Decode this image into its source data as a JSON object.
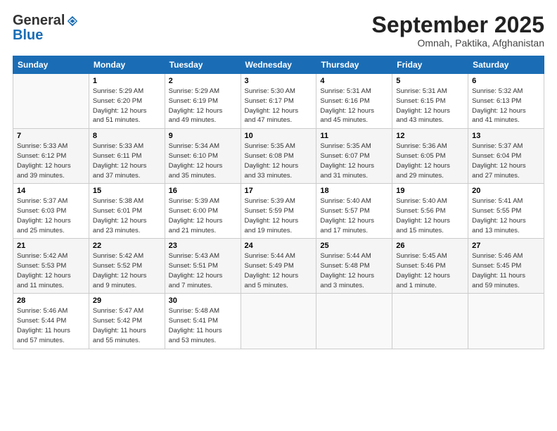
{
  "header": {
    "logo_general": "General",
    "logo_blue": "Blue",
    "month_title": "September 2025",
    "location": "Omnah, Paktika, Afghanistan"
  },
  "columns": [
    "Sunday",
    "Monday",
    "Tuesday",
    "Wednesday",
    "Thursday",
    "Friday",
    "Saturday"
  ],
  "weeks": [
    [
      {
        "day": "",
        "info": ""
      },
      {
        "day": "1",
        "info": "Sunrise: 5:29 AM\nSunset: 6:20 PM\nDaylight: 12 hours\nand 51 minutes."
      },
      {
        "day": "2",
        "info": "Sunrise: 5:29 AM\nSunset: 6:19 PM\nDaylight: 12 hours\nand 49 minutes."
      },
      {
        "day": "3",
        "info": "Sunrise: 5:30 AM\nSunset: 6:17 PM\nDaylight: 12 hours\nand 47 minutes."
      },
      {
        "day": "4",
        "info": "Sunrise: 5:31 AM\nSunset: 6:16 PM\nDaylight: 12 hours\nand 45 minutes."
      },
      {
        "day": "5",
        "info": "Sunrise: 5:31 AM\nSunset: 6:15 PM\nDaylight: 12 hours\nand 43 minutes."
      },
      {
        "day": "6",
        "info": "Sunrise: 5:32 AM\nSunset: 6:13 PM\nDaylight: 12 hours\nand 41 minutes."
      }
    ],
    [
      {
        "day": "7",
        "info": "Sunrise: 5:33 AM\nSunset: 6:12 PM\nDaylight: 12 hours\nand 39 minutes."
      },
      {
        "day": "8",
        "info": "Sunrise: 5:33 AM\nSunset: 6:11 PM\nDaylight: 12 hours\nand 37 minutes."
      },
      {
        "day": "9",
        "info": "Sunrise: 5:34 AM\nSunset: 6:10 PM\nDaylight: 12 hours\nand 35 minutes."
      },
      {
        "day": "10",
        "info": "Sunrise: 5:35 AM\nSunset: 6:08 PM\nDaylight: 12 hours\nand 33 minutes."
      },
      {
        "day": "11",
        "info": "Sunrise: 5:35 AM\nSunset: 6:07 PM\nDaylight: 12 hours\nand 31 minutes."
      },
      {
        "day": "12",
        "info": "Sunrise: 5:36 AM\nSunset: 6:05 PM\nDaylight: 12 hours\nand 29 minutes."
      },
      {
        "day": "13",
        "info": "Sunrise: 5:37 AM\nSunset: 6:04 PM\nDaylight: 12 hours\nand 27 minutes."
      }
    ],
    [
      {
        "day": "14",
        "info": "Sunrise: 5:37 AM\nSunset: 6:03 PM\nDaylight: 12 hours\nand 25 minutes."
      },
      {
        "day": "15",
        "info": "Sunrise: 5:38 AM\nSunset: 6:01 PM\nDaylight: 12 hours\nand 23 minutes."
      },
      {
        "day": "16",
        "info": "Sunrise: 5:39 AM\nSunset: 6:00 PM\nDaylight: 12 hours\nand 21 minutes."
      },
      {
        "day": "17",
        "info": "Sunrise: 5:39 AM\nSunset: 5:59 PM\nDaylight: 12 hours\nand 19 minutes."
      },
      {
        "day": "18",
        "info": "Sunrise: 5:40 AM\nSunset: 5:57 PM\nDaylight: 12 hours\nand 17 minutes."
      },
      {
        "day": "19",
        "info": "Sunrise: 5:40 AM\nSunset: 5:56 PM\nDaylight: 12 hours\nand 15 minutes."
      },
      {
        "day": "20",
        "info": "Sunrise: 5:41 AM\nSunset: 5:55 PM\nDaylight: 12 hours\nand 13 minutes."
      }
    ],
    [
      {
        "day": "21",
        "info": "Sunrise: 5:42 AM\nSunset: 5:53 PM\nDaylight: 12 hours\nand 11 minutes."
      },
      {
        "day": "22",
        "info": "Sunrise: 5:42 AM\nSunset: 5:52 PM\nDaylight: 12 hours\nand 9 minutes."
      },
      {
        "day": "23",
        "info": "Sunrise: 5:43 AM\nSunset: 5:51 PM\nDaylight: 12 hours\nand 7 minutes."
      },
      {
        "day": "24",
        "info": "Sunrise: 5:44 AM\nSunset: 5:49 PM\nDaylight: 12 hours\nand 5 minutes."
      },
      {
        "day": "25",
        "info": "Sunrise: 5:44 AM\nSunset: 5:48 PM\nDaylight: 12 hours\nand 3 minutes."
      },
      {
        "day": "26",
        "info": "Sunrise: 5:45 AM\nSunset: 5:46 PM\nDaylight: 12 hours\nand 1 minute."
      },
      {
        "day": "27",
        "info": "Sunrise: 5:46 AM\nSunset: 5:45 PM\nDaylight: 11 hours\nand 59 minutes."
      }
    ],
    [
      {
        "day": "28",
        "info": "Sunrise: 5:46 AM\nSunset: 5:44 PM\nDaylight: 11 hours\nand 57 minutes."
      },
      {
        "day": "29",
        "info": "Sunrise: 5:47 AM\nSunset: 5:42 PM\nDaylight: 11 hours\nand 55 minutes."
      },
      {
        "day": "30",
        "info": "Sunrise: 5:48 AM\nSunset: 5:41 PM\nDaylight: 11 hours\nand 53 minutes."
      },
      {
        "day": "",
        "info": ""
      },
      {
        "day": "",
        "info": ""
      },
      {
        "day": "",
        "info": ""
      },
      {
        "day": "",
        "info": ""
      }
    ]
  ]
}
